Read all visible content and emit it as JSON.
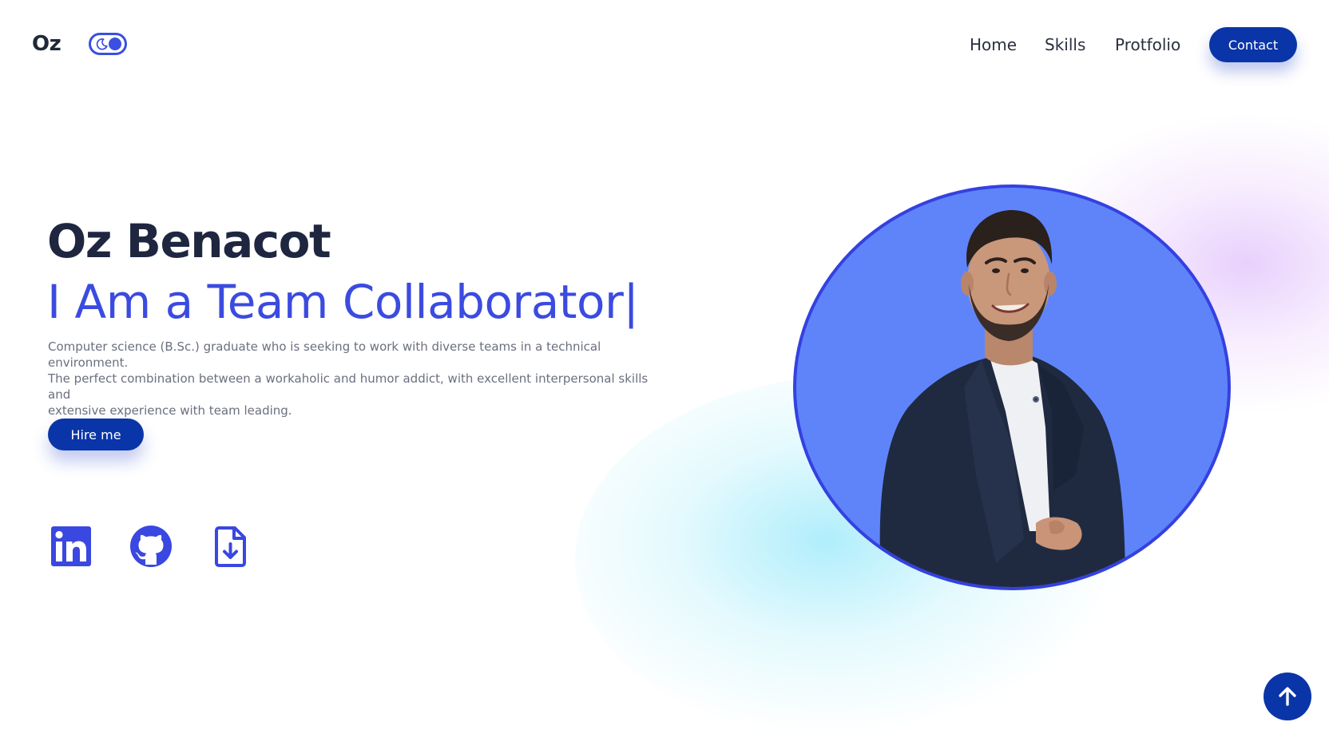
{
  "header": {
    "logo": "Oz",
    "theme_toggle": {
      "icon": "moon-icon",
      "state": "on"
    },
    "nav": {
      "home": "Home",
      "skills": "Skills",
      "portfolio": "Protfolio"
    },
    "contact_label": "Contact"
  },
  "hero": {
    "name": "Oz Benacot",
    "tagline": "I Am a Team Collaborator|",
    "description": [
      "Computer science (B.Sc.) graduate who is seeking to work with diverse teams in a technical environment.",
      "The perfect combination between a workaholic and humor addict, with excellent interpersonal skills and",
      "extensive experience with team leading."
    ],
    "hire_label": "Hire me",
    "socials": [
      "linkedin-icon",
      "github-icon",
      "file-download-icon"
    ]
  },
  "portrait": {
    "subject": "portrait-photo",
    "background_color": "#5f84fa",
    "border_color": "#3441e0"
  },
  "scroll_top": {
    "icon": "arrow-up-icon"
  },
  "colors": {
    "accent": "#0a35a8",
    "tagline": "#3b4be0",
    "heading": "#1f2640",
    "body_text": "#6b6f80"
  }
}
